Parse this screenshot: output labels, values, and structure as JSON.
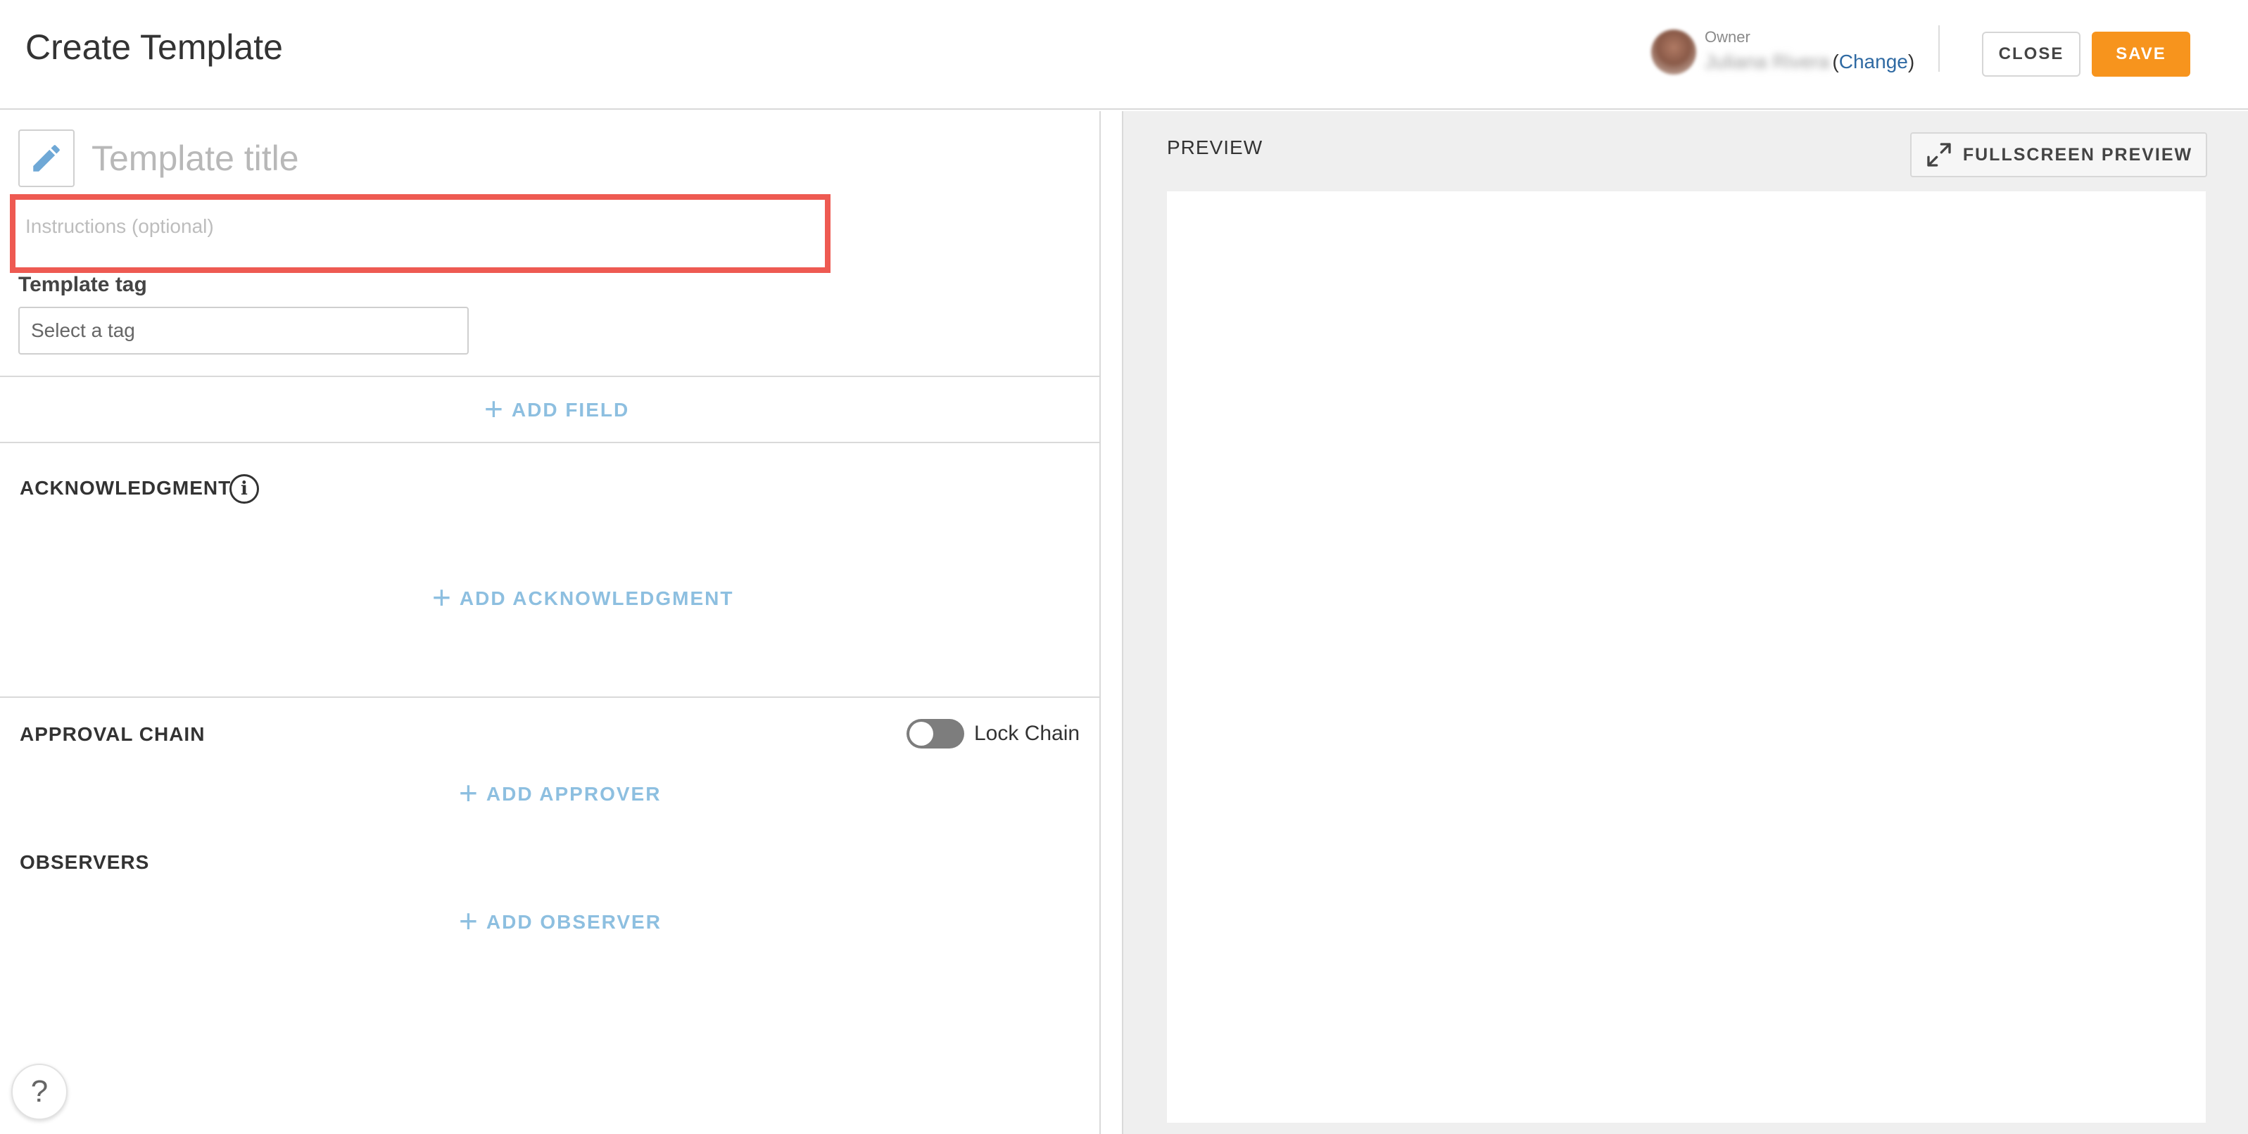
{
  "header": {
    "title": "Create Template",
    "owner": {
      "label": "Owner",
      "name": "Juliana Rivera",
      "change_open": "(",
      "change_link": "Change",
      "change_close": ")"
    },
    "close_label": "CLOSE",
    "save_label": "SAVE"
  },
  "form": {
    "title_placeholder": "Template title",
    "instructions_placeholder": "Instructions (optional)",
    "tag_label": "Template tag",
    "tag_placeholder": "Select a tag",
    "add_field_label": "ADD FIELD"
  },
  "acknowledgment": {
    "title": "ACKNOWLEDGMENT",
    "info_glyph": "i",
    "add_label": "ADD ACKNOWLEDGMENT"
  },
  "approval_chain": {
    "title": "APPROVAL CHAIN",
    "lock_label": "Lock Chain",
    "lock_enabled": false,
    "add_label": "ADD APPROVER"
  },
  "observers": {
    "title": "OBSERVERS",
    "add_label": "ADD OBSERVER"
  },
  "preview": {
    "label": "PREVIEW",
    "fullscreen_label": "FULLSCREEN PREVIEW"
  },
  "help": {
    "glyph": "?"
  },
  "colors": {
    "accent_save": "#f7941d",
    "link_blue": "#2f6aa3",
    "add_link": "#8dbfe0",
    "highlight": "#ee5a52",
    "preview_bg": "#efefef"
  },
  "icons": {
    "pencil": "pencil-icon",
    "info": "info-icon",
    "plus": "plus-icon",
    "expand": "expand-icon",
    "help": "help-icon"
  }
}
